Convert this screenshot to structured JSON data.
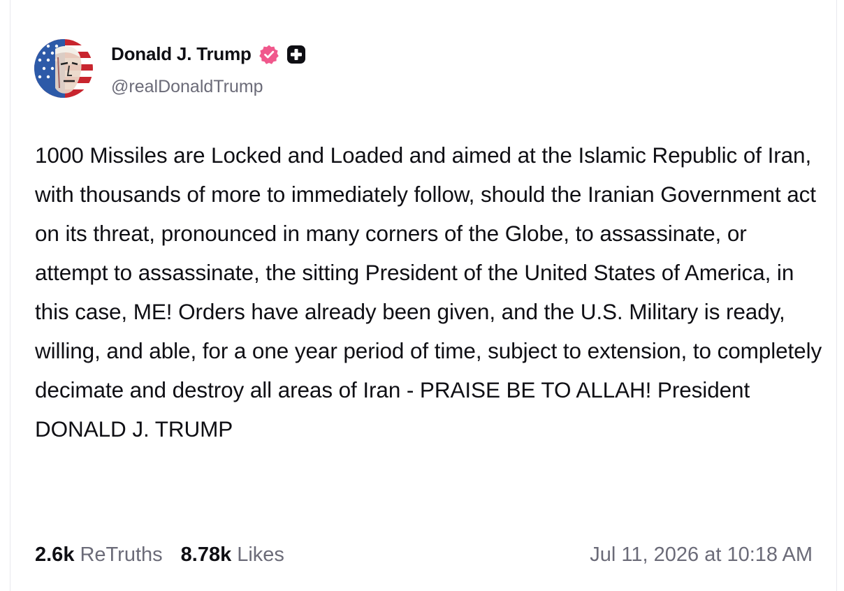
{
  "post": {
    "author": {
      "display_name": "Donald J. Trump",
      "handle": "@realDonaldTrump",
      "avatar_icon": "avatar-flag-portrait",
      "verified_icon": "verified-badge-icon",
      "verified_color": "#f0588c",
      "plus_icon": "plus-badge-icon"
    },
    "text": "1000 Missiles are Locked and Loaded and aimed at the Islamic Republic of Iran, with thousands of more to immediately follow, should the Iranian Government act on its threat, pronounced in many corners of the Globe, to assassinate, or attempt to assassinate, the sitting President of the United States of America, in this case, ME! Orders have already been given, and the U.S. Military is ready, willing, and able, for a one year period of time, subject to extension, to completely decimate and destroy all areas of Iran - PRAISE BE TO ALLAH! President DONALD J. TRUMP",
    "stats": {
      "retruths_count": "2.6k",
      "retruths_label": "ReTruths",
      "likes_count": "8.78k",
      "likes_label": "Likes"
    },
    "timestamp": "Jul 11, 2026 at 10:18 AM"
  },
  "colors": {
    "text_primary": "#0f0f14",
    "text_secondary": "#6b6b78",
    "verified": "#f0588c"
  }
}
